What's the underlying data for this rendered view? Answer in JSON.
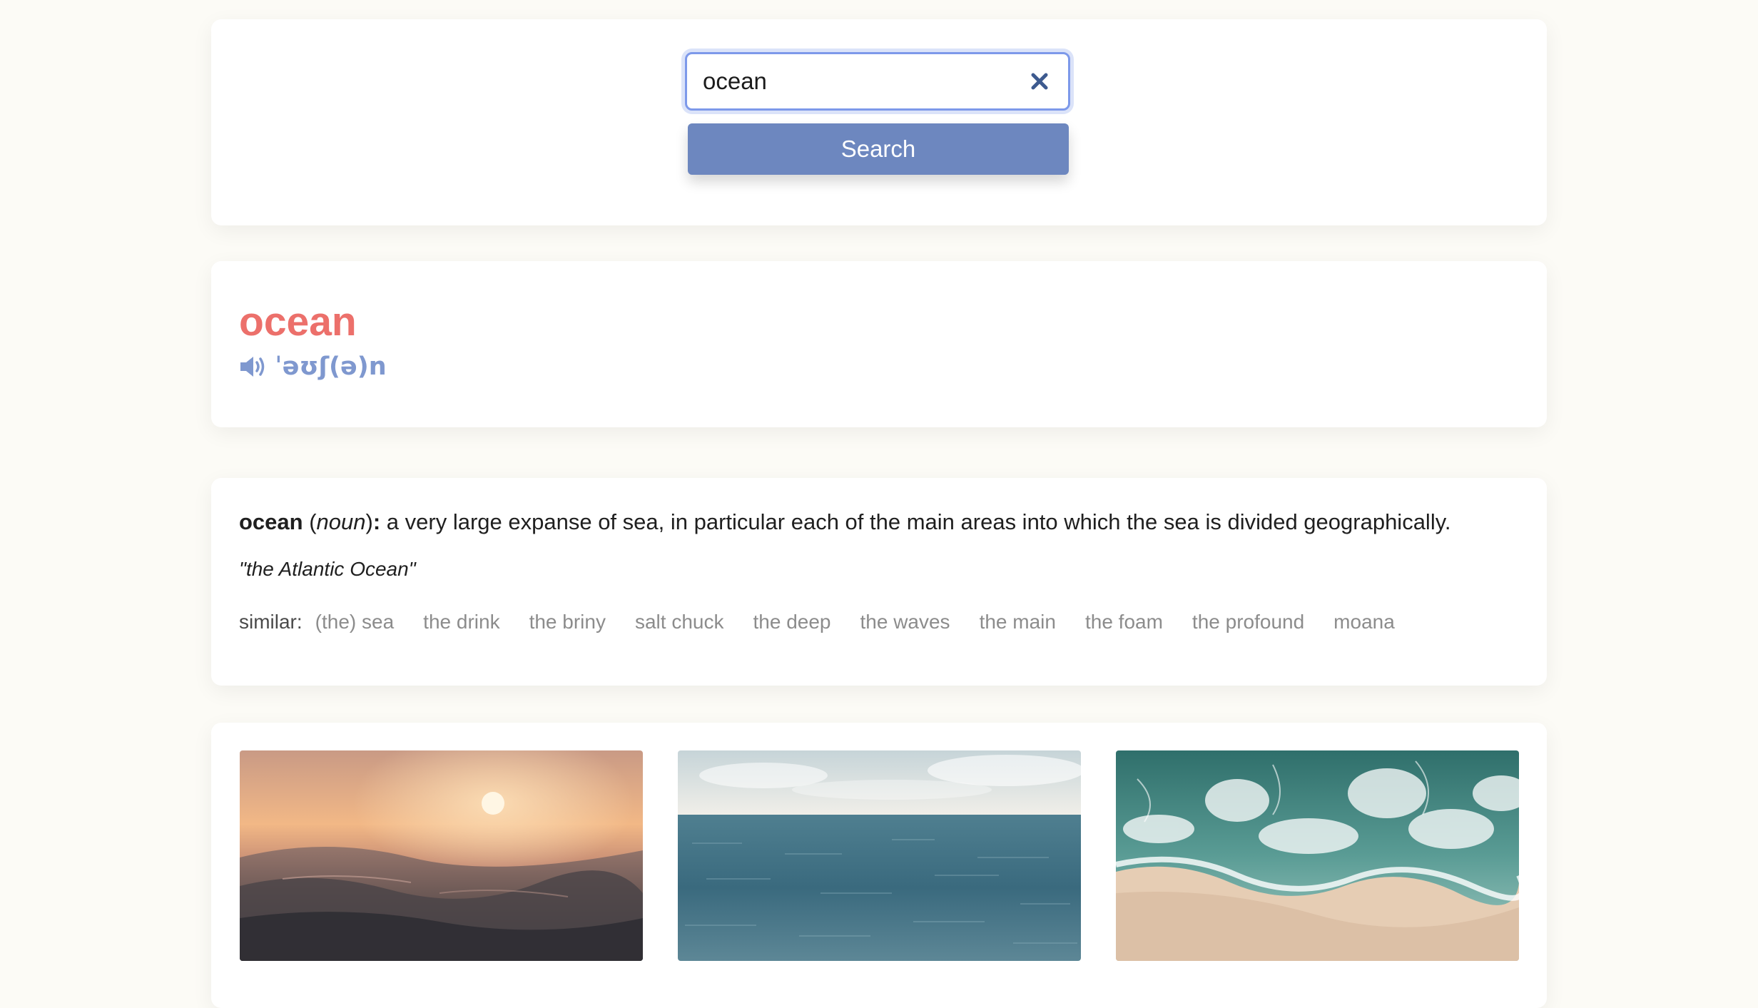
{
  "search": {
    "value": "ocean",
    "button_label": "Search"
  },
  "word": {
    "headword": "ocean",
    "phonetic": "ˈəʊʃ(ə)n"
  },
  "definition": {
    "word": "ocean",
    "part_of_speech": "noun",
    "text": "a very large expanse of sea, in particular each of the main areas into which the sea is divided geographically.",
    "example": "\"the Atlantic Ocean\"",
    "similar_label": "similar:",
    "similar": [
      "(the) sea",
      "the drink",
      "the briny",
      "salt chuck",
      "the deep",
      "the waves",
      "the main",
      "the foam",
      "the profound",
      "moana"
    ]
  },
  "images": [
    {
      "name": "sunset-wave-photo"
    },
    {
      "name": "open-sea-photo"
    },
    {
      "name": "aerial-beach-photo"
    }
  ],
  "colors": {
    "headword": "#ec706b",
    "phonetic": "#7f98cf",
    "button": "#6d87bf",
    "focus_ring": "#7d99ea",
    "background": "#fcfbf6"
  }
}
